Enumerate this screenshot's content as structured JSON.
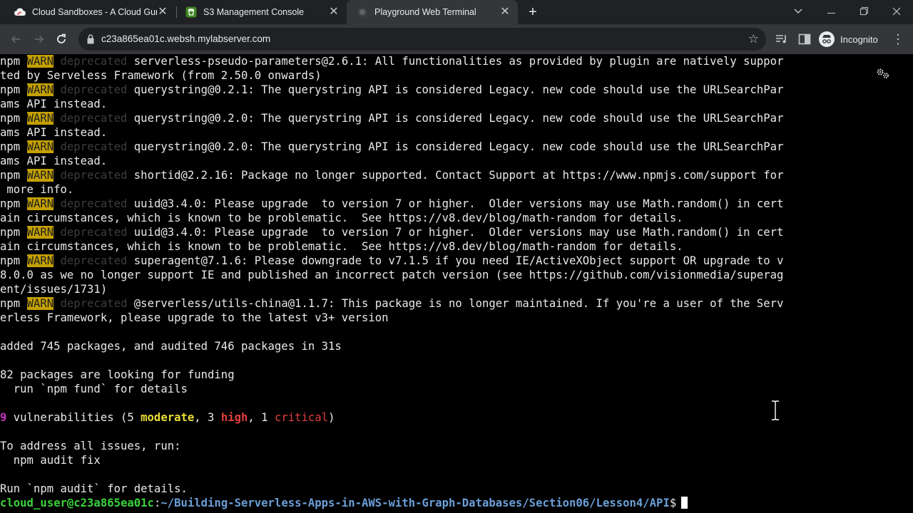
{
  "tabs": [
    {
      "title": "Cloud Sandboxes - A Cloud Guru",
      "icon": "acloudguru-icon"
    },
    {
      "title": "S3 Management Console",
      "icon": "aws-s3-icon"
    },
    {
      "title": "Playground Web Terminal",
      "icon": "terminal-icon"
    }
  ],
  "toolbar": {
    "url": "c23a865ea01c.websh.mylabserver.com",
    "profile_label": "Incognito"
  },
  "colors": {
    "tab_strip": "#202124",
    "toolbar": "#35363a",
    "terminal_bg": "#000000",
    "warn_bg": "#c5a100",
    "prompt_green": "#39d339",
    "prompt_blue": "#6a9fd8"
  },
  "terminal": {
    "npm": "npm",
    "warn": "WARN",
    "deprecated": "deprecated",
    "warnings": [
      {
        "msg": "serverless-pseudo-parameters@2.6.1: All functionalities as provided by plugin are natively suppor",
        "cont": "ted by Serveless Framework (from 2.50.0 onwards)"
      },
      {
        "msg": "querystring@0.2.1: The querystring API is considered Legacy. new code should use the URLSearchPar",
        "cont": "ams API instead."
      },
      {
        "msg": "querystring@0.2.0: The querystring API is considered Legacy. new code should use the URLSearchPar",
        "cont": "ams API instead."
      },
      {
        "msg": "querystring@0.2.0: The querystring API is considered Legacy. new code should use the URLSearchPar",
        "cont": "ams API instead."
      },
      {
        "msg": "shortid@2.2.16: Package no longer supported. Contact Support at https://www.npmjs.com/support for",
        "cont": " more info."
      },
      {
        "msg": "uuid@3.4.0: Please upgrade  to version 7 or higher.  Older versions may use Math.random() in cert",
        "cont": "ain circumstances, which is known to be problematic.  See https://v8.dev/blog/math-random for details."
      },
      {
        "msg": "uuid@3.4.0: Please upgrade  to version 7 or higher.  Older versions may use Math.random() in cert",
        "cont": "ain circumstances, which is known to be problematic.  See https://v8.dev/blog/math-random for details."
      },
      {
        "msg": "superagent@7.1.6: Please downgrade to v7.1.5 if you need IE/ActiveXObject support OR upgrade to v",
        "cont": "8.0.0 as we no longer support IE and published an incorrect patch version (see https://github.com/visionmedia/superag",
        "cont2": "ent/issues/1731)"
      },
      {
        "msg": "@serverless/utils-china@1.1.7: This package is no longer maintained. If you're a user of the Serv",
        "cont": "erless Framework, please upgrade to the latest v3+ version"
      }
    ],
    "added": "added 745 packages, and audited 746 packages in 31s",
    "funding_1": "82 packages are looking for funding",
    "funding_2": "  run `npm fund` for details",
    "vuln_count": "9",
    "vuln_pre": " vulnerabilities (5 ",
    "vuln_moderate": "moderate",
    "vuln_mid": ", 3 ",
    "vuln_high": "high",
    "vuln_mid2": ", 1 ",
    "vuln_critical": "critical",
    "vuln_end": ")",
    "address_1": "To address all issues, run:",
    "address_2": "  npm audit fix",
    "run_audit": "Run `npm audit` for details.",
    "prompt_user": "cloud_user@c23a865ea01c",
    "prompt_colon": ":",
    "prompt_path": "~/Building-Serverless-Apps-in-AWS-with-Graph-Databases/Section06/Lesson4/API",
    "prompt_symbol": "$"
  }
}
